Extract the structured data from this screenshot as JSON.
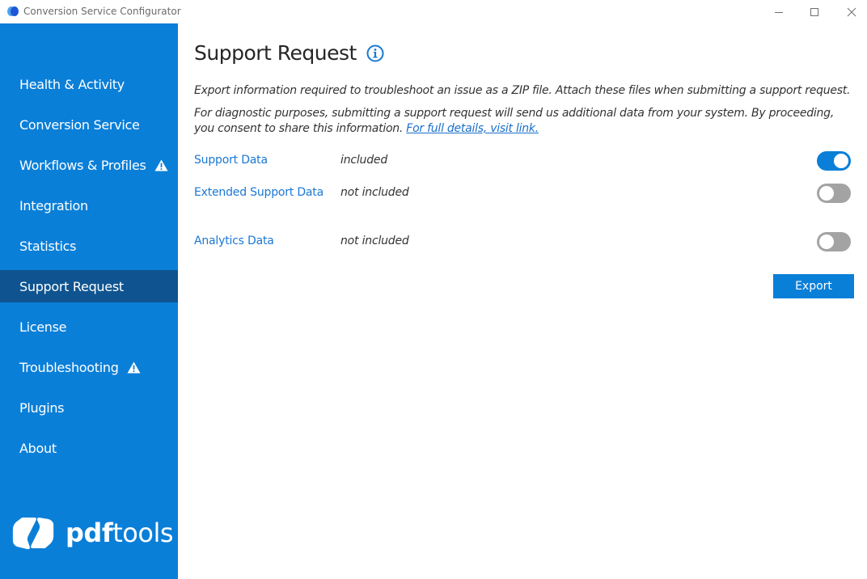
{
  "window": {
    "title": "Conversion Service Configurator",
    "controls": [
      "minimize",
      "maximize",
      "close"
    ]
  },
  "sidebar": {
    "items": [
      {
        "label": "Health & Activity",
        "warning": false,
        "active": false
      },
      {
        "label": "Conversion Service",
        "warning": false,
        "active": false
      },
      {
        "label": "Workflows & Profiles",
        "warning": true,
        "active": false
      },
      {
        "label": "Integration",
        "warning": false,
        "active": false
      },
      {
        "label": "Statistics",
        "warning": false,
        "active": false
      },
      {
        "label": "Support Request",
        "warning": false,
        "active": true
      },
      {
        "label": "License",
        "warning": false,
        "active": false
      },
      {
        "label": "Troubleshooting",
        "warning": true,
        "active": false
      },
      {
        "label": "Plugins",
        "warning": false,
        "active": false
      },
      {
        "label": "About",
        "warning": false,
        "active": false
      }
    ],
    "logo": {
      "bold": "pdf",
      "regular": "tools"
    }
  },
  "main": {
    "title": "Support Request",
    "description": "Export information required to troubleshoot an issue as a ZIP file. Attach these files when submitting a support request.",
    "consent_text": "For diagnostic purposes, submitting a support request will send us additional data from your system. By proceeding, you consent to share this information.",
    "consent_link": "For full details, visit link.",
    "options": [
      {
        "label": "Support Data",
        "status": "included",
        "enabled": true
      },
      {
        "label": "Extended Support Data",
        "status": "not included",
        "enabled": false
      },
      {
        "label": "Analytics Data",
        "status": "not included",
        "enabled": false
      }
    ],
    "export_label": "Export"
  },
  "colors": {
    "accent": "#0a7fd8",
    "sidebar_active": "#0f5490",
    "toggle_off": "#a3a3a3",
    "link": "#1a78d4"
  }
}
